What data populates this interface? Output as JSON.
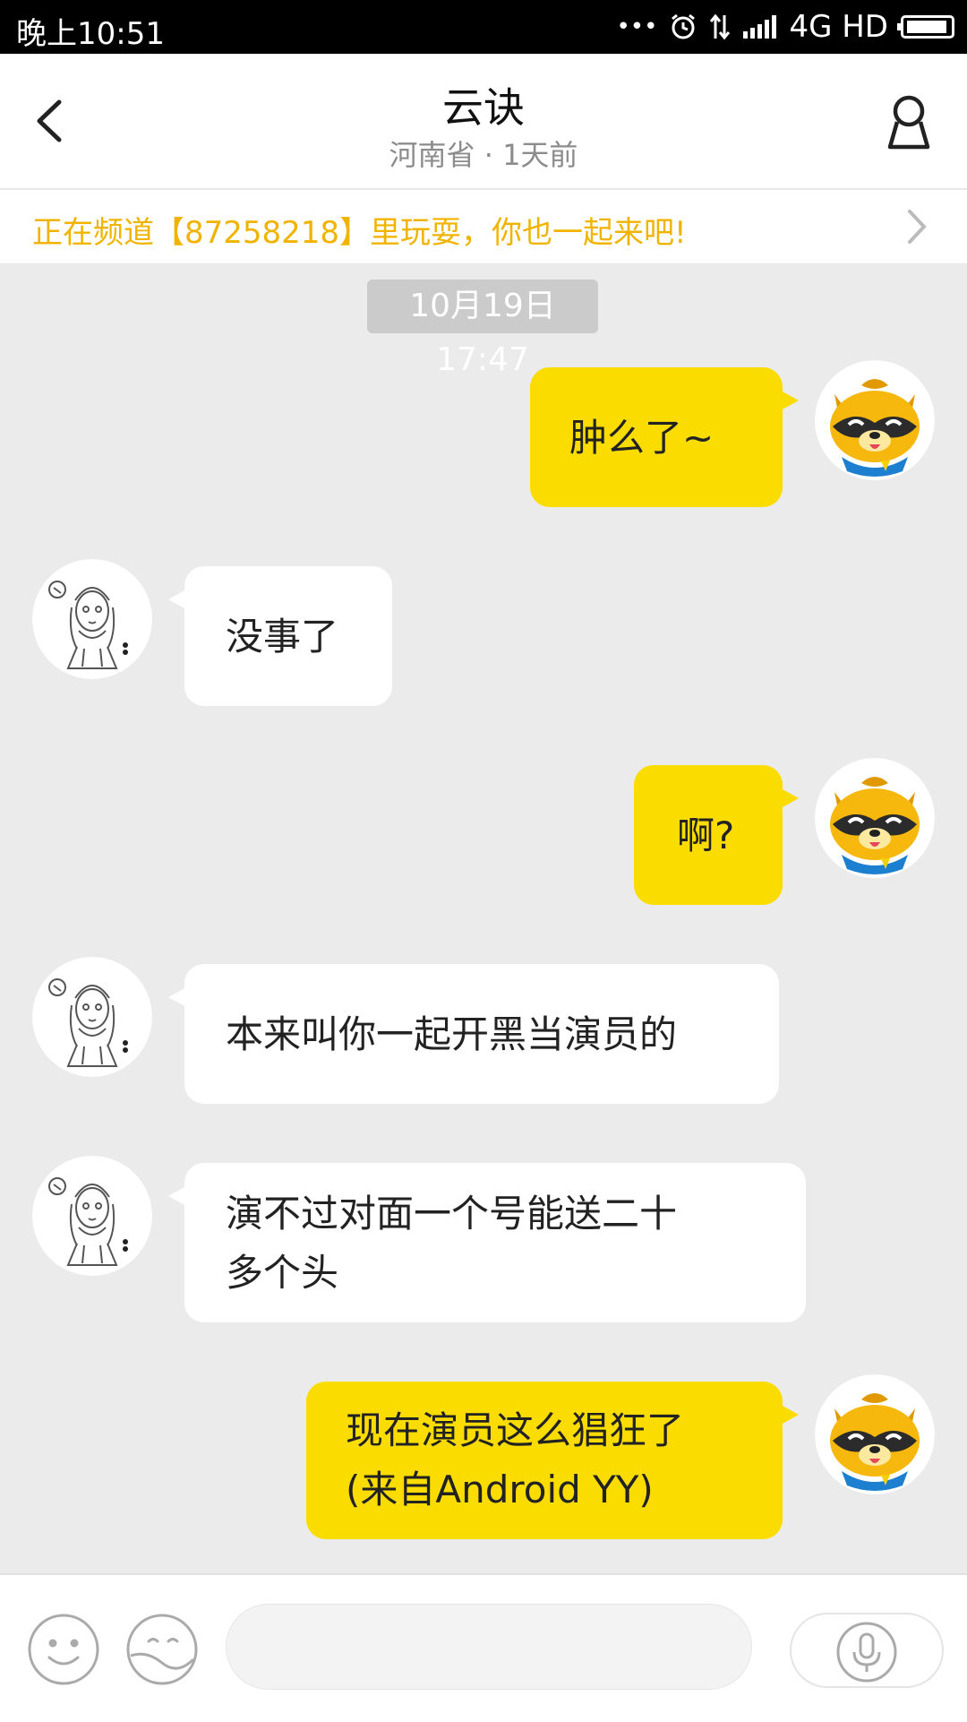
{
  "status_bar": {
    "time": "晚上10:51",
    "dots": "•••",
    "alarm_icon": "alarm-icon",
    "data_icon": "data-transfer-icon",
    "network": "4G HD",
    "battery_icon": "battery-icon"
  },
  "header": {
    "title": "云诀",
    "subtitle": "河南省 · 1天前",
    "back_icon": "chevron-left-icon",
    "profile_icon": "user-profile-icon"
  },
  "banner": {
    "text": "正在频道【87258218】里玩耍，你也一起来吧!",
    "arrow_icon": "chevron-right-icon",
    "text_color": "#f0b400"
  },
  "timestamp": "10月19日 17:47",
  "messages": [
    {
      "sender": "me",
      "text": "肿么了~"
    },
    {
      "sender": "them",
      "text": "没事了"
    },
    {
      "sender": "me",
      "text": "啊?"
    },
    {
      "sender": "them",
      "text": "本来叫你一起开黑当演员的"
    },
    {
      "sender": "them",
      "lines": [
        "演不过对面一个号能送二十",
        "多个头"
      ]
    },
    {
      "sender": "me",
      "lines": [
        "现在演员这么猖狂了",
        "(来自Android YY)"
      ]
    }
  ],
  "avatars": {
    "me": "yy-raccoon-mascot-avatar",
    "them": "sketch-girl-avatar"
  },
  "input_bar": {
    "emoji_icon": "emoji-icon",
    "sticker_icon": "sticker-icon",
    "input_value": "",
    "input_placeholder": "",
    "voice_icon": "microphone-icon"
  },
  "colors": {
    "my_bubble": "#fadc00",
    "their_bubble": "#ffffff",
    "chat_background": "#ebebeb",
    "accent": "#f0b400"
  }
}
